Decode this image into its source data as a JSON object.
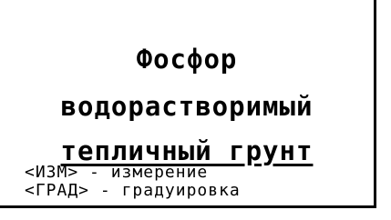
{
  "screen": {
    "title_line1": "Фосфор",
    "title_line2": "водорастворимый",
    "subtitle": "тепличный грунт",
    "hints": [
      {
        "key": "<ИЗМ>",
        "separator": "-",
        "action": "измерение"
      },
      {
        "key": "<ГРАД>",
        "separator": "-",
        "action": "градуировка"
      }
    ]
  },
  "colors": {
    "background": "#ffffff",
    "text": "#000000"
  }
}
